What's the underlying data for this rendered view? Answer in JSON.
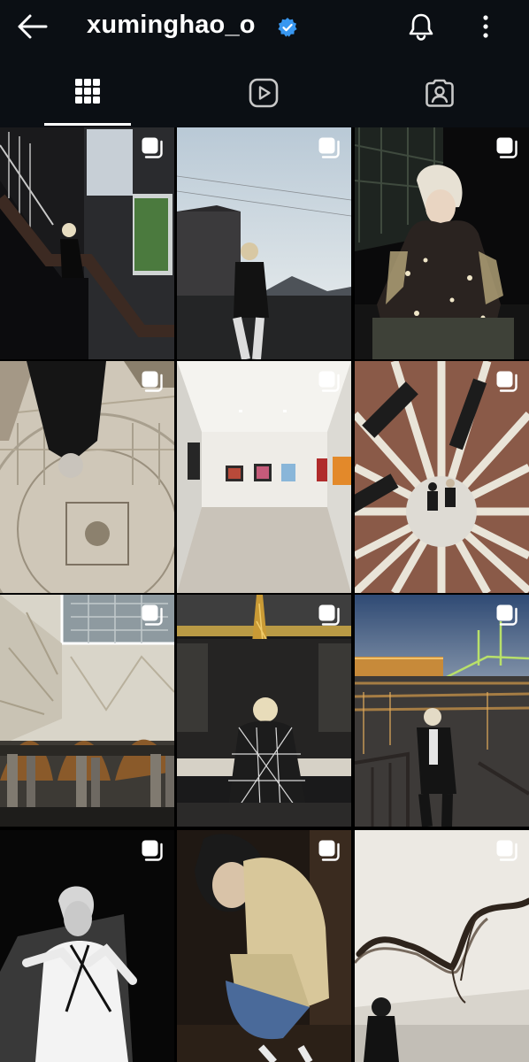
{
  "header": {
    "username": "xuminghao_o",
    "verified": true
  },
  "tabs": [
    {
      "name": "posts",
      "icon": "grid-icon",
      "active": true
    },
    {
      "name": "reels",
      "icon": "reels-icon",
      "active": false
    },
    {
      "name": "tagged",
      "icon": "tagged-icon",
      "active": false
    }
  ],
  "posts": [
    {
      "scene": "staircase-window",
      "icon": "carousel-icon"
    },
    {
      "scene": "rooftop-sky",
      "icon": "carousel-icon"
    },
    {
      "scene": "night-sequin-jacket",
      "icon": "carousel-icon"
    },
    {
      "scene": "ornate-ceiling",
      "icon": "carousel-icon"
    },
    {
      "scene": "gallery-room",
      "icon": "carousel-icon"
    },
    {
      "scene": "aerial-plaza",
      "icon": "carousel-icon"
    },
    {
      "scene": "arched-hall",
      "icon": "carousel-icon"
    },
    {
      "scene": "eiffel-tower-runway",
      "icon": "carousel-icon"
    },
    {
      "scene": "river-night-bridge",
      "icon": "carousel-icon"
    },
    {
      "scene": "black-white-portrait",
      "icon": "carousel-icon"
    },
    {
      "scene": "crouching-trench-coat",
      "icon": "carousel-icon"
    },
    {
      "scene": "ink-painting-wall",
      "icon": "carousel-icon"
    }
  ],
  "colors": {
    "header_bg": "#0b0f14",
    "verified_blue": "#3897f0"
  }
}
